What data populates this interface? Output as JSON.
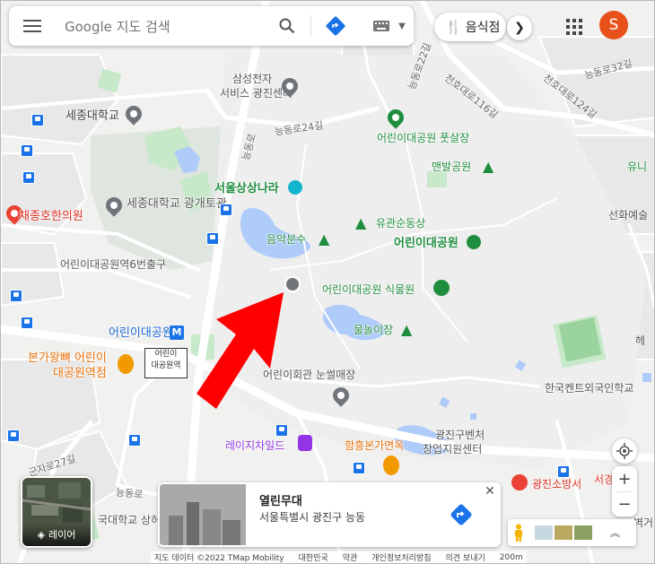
{
  "search": {
    "placeholder": "Google 지도 검색"
  },
  "chips": {
    "restaurant": "음식점"
  },
  "account": {
    "initial": "S",
    "color": "#e8511a"
  },
  "layer": {
    "label": "레이어"
  },
  "place_card": {
    "name": "열린무대",
    "address": "서울특별시 광진구 능동"
  },
  "attribution": {
    "data": "지도 데이터 ©2022 TMap Mobility",
    "country": "대한민국",
    "terms": "약관",
    "privacy": "개인정보처리방침",
    "feedback": "의견 보내기",
    "scale": "200m"
  },
  "labels": {
    "samsung1": "삼성전자",
    "samsung2": "서비스 광진센터",
    "neungdongro24": "능동로24길",
    "neungdongro": "능동로",
    "neungdongro22": "능동로22길",
    "neungdongro32": "능동로32길",
    "cheonho116": "천호대로116길",
    "cheonho124": "천호대로124길",
    "futsal": "어린이대공원 풋살장",
    "sejong_univ": "세종대학교",
    "sejong_hall": "세종대학교 광개토관",
    "manbal": "맨발공원",
    "yuni": "유니",
    "seoul_sangsang": "서울상상나라",
    "chae": "채종호한의원",
    "yugwan": "유관순동상",
    "seonhwa": "선화예술",
    "eumak": "음악분수",
    "park": "어린이대공원",
    "exit6": "어린이대공원역6번출구",
    "botanic": "어린이대공원 식물원",
    "station": "어린이대공원",
    "mulnori": "물놀이장",
    "station_box1": "어린이",
    "station_box2": "대공원역",
    "bon1": "본가왕뼈 어린이",
    "bon2": "대공원역점",
    "snowsled": "어린이회관 눈썰매장",
    "kent": "한국켄트외국인학교",
    "gwangjin_venture1": "광진구벤처",
    "gwangjin_venture2": "창업지원센터",
    "leisure": "레이지차일드",
    "hamheung": "함흥본가면옥",
    "gunja": "군자로27길",
    "neungdongro_bottom": "능동로",
    "gwangjin_fire": "광진소방서",
    "seokyeong": "서경",
    "konkuk": "국대학교 상허",
    "byeok": "벽거",
    "he": "헤"
  }
}
